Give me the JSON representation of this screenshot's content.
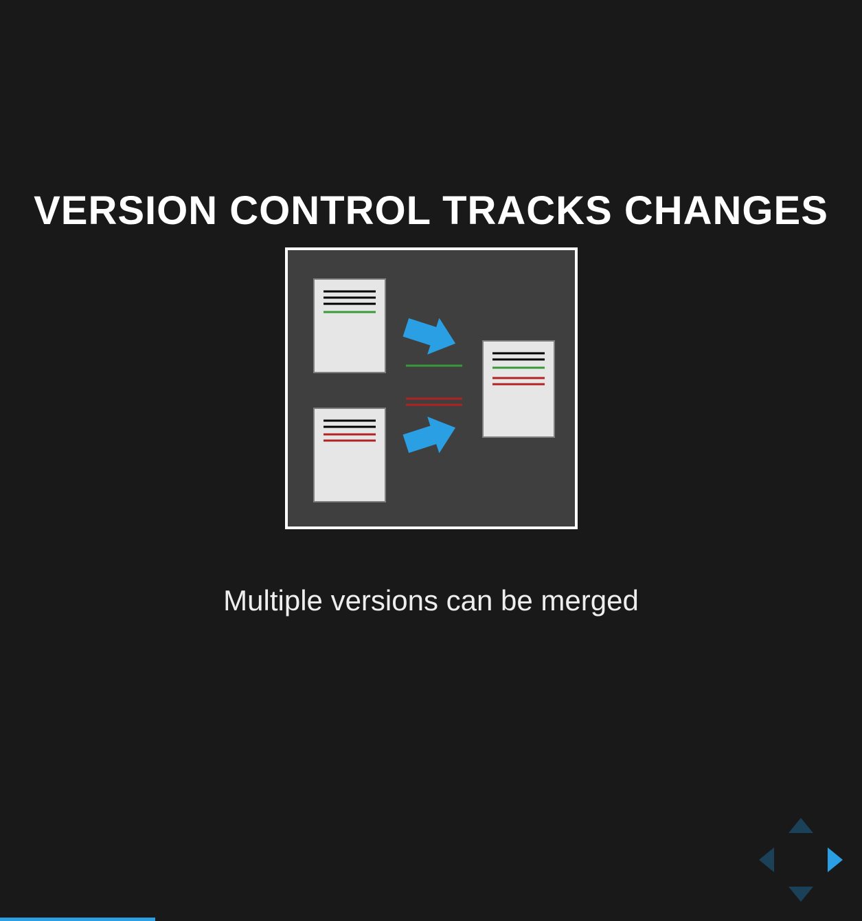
{
  "slide": {
    "title": "VERSION CONTROL TRACKS CHANGES",
    "caption": "Multiple versions can be merged"
  },
  "diagram": {
    "inputs": [
      {
        "lines": [
          "black",
          "black",
          "black",
          "green"
        ]
      },
      {
        "lines": [
          "black",
          "black",
          "red",
          "red"
        ]
      }
    ],
    "diff_snippets": {
      "green_line": true,
      "red_lines": 2
    },
    "output": {
      "lines": [
        "black",
        "black",
        "green",
        "red",
        "red"
      ]
    },
    "arrow_color": "#2a9fe4"
  },
  "nav": {
    "up_enabled": false,
    "down_enabled": false,
    "left_enabled": false,
    "right_enabled": true,
    "active_color": "#2a9fe4",
    "inactive_color": "#1a4158"
  },
  "progress": {
    "fraction_percent": 18
  }
}
